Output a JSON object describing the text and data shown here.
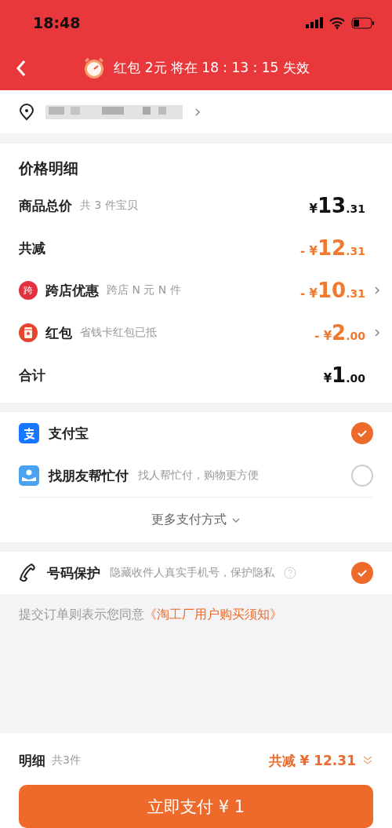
{
  "status_bar": {
    "time": "18:48"
  },
  "nav": {
    "title": "红包 2元 将在 18 : 13 : 15 失效"
  },
  "price_detail": {
    "title": "价格明细",
    "rows": [
      {
        "kind": "total",
        "label": "商品总价",
        "note": "共 3 件宝贝",
        "sign": "¥",
        "int": "13",
        "dec": ".31",
        "arrow": false
      },
      {
        "kind": "discount",
        "label": "共减",
        "sign": "- ¥",
        "int": "12",
        "dec": ".31",
        "arrow": false
      },
      {
        "kind": "discount",
        "icon_text": "跨",
        "label": "跨店优惠",
        "note": "跨店 N 元 N 件",
        "sign": "- ¥",
        "int": "10",
        "dec": ".31",
        "arrow": true
      },
      {
        "kind": "discount",
        "label": "红包",
        "note": "省钱卡红包已抵",
        "sign": "- ¥",
        "int": "2",
        "dec": ".00",
        "arrow": true
      },
      {
        "kind": "total",
        "label": "合计",
        "sign": "¥",
        "int": "1",
        "dec": ".00",
        "arrow": false
      }
    ]
  },
  "payment": {
    "methods": [
      {
        "name": "支付宝",
        "selected": true
      },
      {
        "name": "找朋友帮忙付",
        "note": "找人帮忙付，购物更方便",
        "selected": false
      }
    ],
    "more": "更多支付方式"
  },
  "phone_protection": {
    "label": "号码保护",
    "note": "隐藏收件人真实手机号，保护隐私",
    "checked": true
  },
  "agreement": {
    "text": "提交订单则表示您同意",
    "link": "《淘工厂用户购买须知》"
  },
  "footer": {
    "label": "明细",
    "count": "共3件",
    "saving": "共减 ¥ 12.31",
    "pay_button": "立即支付 ¥ 1"
  }
}
